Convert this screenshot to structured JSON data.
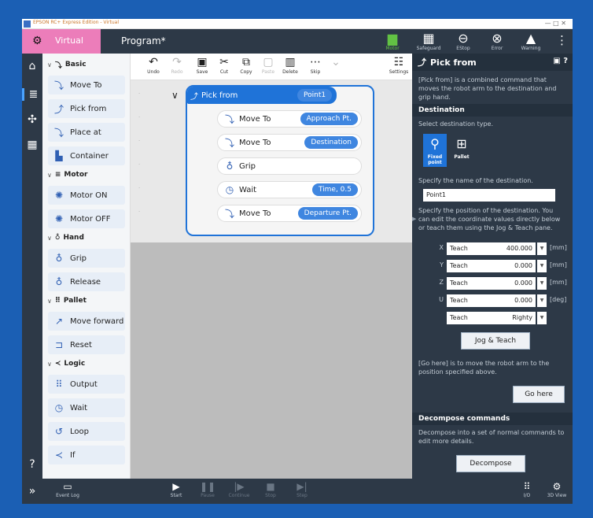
{
  "window": {
    "title": "EPSON RC+ Express Edition - Virtual"
  },
  "appbar": {
    "mode_label": "Virtual",
    "program_title": "Program*",
    "status": {
      "motor": "Motor",
      "safeguard": "Safeguard",
      "estop": "EStop",
      "error": "Error",
      "warning": "Warning"
    }
  },
  "palette": {
    "categories": {
      "basic": "Basic",
      "motor": "Motor",
      "hand": "Hand",
      "pallet": "Pallet",
      "logic": "Logic"
    },
    "items": {
      "move_to": "Move To",
      "pick_from": "Pick from",
      "place_at": "Place at",
      "container": "Container",
      "motor_on": "Motor ON",
      "motor_off": "Motor OFF",
      "grip": "Grip",
      "release": "Release",
      "move_forward": "Move forward",
      "reset": "Reset",
      "output": "Output",
      "wait": "Wait",
      "loop": "Loop",
      "if": "If"
    }
  },
  "toolbar": {
    "undo": "Undo",
    "redo": "Redo",
    "save": "Save",
    "cut": "Cut",
    "copy": "Copy",
    "paste": "Paste",
    "delete": "Delete",
    "skip": "Skip",
    "settings": "Settings"
  },
  "program": {
    "block": {
      "label": "Pick from",
      "chip": "Point1"
    },
    "commands": [
      {
        "label": "Move To",
        "chip": "Approach Pt."
      },
      {
        "label": "Move To",
        "chip": "Destination"
      },
      {
        "label": "Grip",
        "chip": ""
      },
      {
        "label": "Wait",
        "chip": "Time, 0.5"
      },
      {
        "label": "Move To",
        "chip": "Departure Pt."
      }
    ]
  },
  "props": {
    "title": "Pick from",
    "description": "[Pick from] is a combined command that moves the robot arm to the destination and grip hand.",
    "destination_header": "Destination",
    "select_type_text": "Select destination type.",
    "type_fixed": "Fixed point",
    "type_pallet": "Pallet",
    "name_text": "Specify the name of the destination.",
    "name_value": "Point1",
    "position_text": "Specify the position of the destination. You can edit the coordinate values directly below or teach them using the Jog & Teach pane.",
    "coords": [
      {
        "axis": "X",
        "mode": "Teach",
        "value": "400.000",
        "unit": "[mm]"
      },
      {
        "axis": "Y",
        "mode": "Teach",
        "value": "0.000",
        "unit": "[mm]"
      },
      {
        "axis": "Z",
        "mode": "Teach",
        "value": "0.000",
        "unit": "[mm]"
      },
      {
        "axis": "U",
        "mode": "Teach",
        "value": "0.000",
        "unit": "[deg]"
      },
      {
        "axis": "",
        "mode": "Teach",
        "value": "Righty",
        "unit": ""
      }
    ],
    "jog_teach": "Jog & Teach",
    "go_here_text": "[Go here] is to move the robot arm to the position specified above.",
    "go_here": "Go here",
    "decompose_header": "Decompose commands",
    "decompose_text": "Decompose into a set of normal commands to edit more details.",
    "decompose": "Decompose"
  },
  "bottombar": {
    "event_log": "Event Log",
    "start": "Start",
    "pause": "Pause",
    "continue": "Continue",
    "stop": "Stop",
    "step": "Step",
    "io": "I/O",
    "view3d": "3D View"
  }
}
